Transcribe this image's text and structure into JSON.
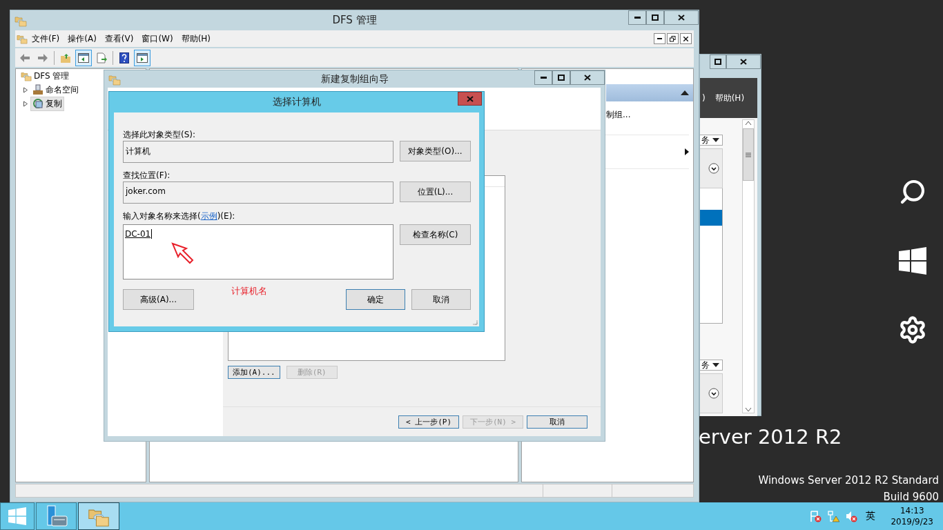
{
  "desktop": {
    "brand_text": "erver 2012 R2",
    "edition": "Windows Server 2012 R2 Standard",
    "build": "Build 9600"
  },
  "charms": [
    {
      "kind": "search"
    },
    {
      "kind": "start"
    },
    {
      "kind": "settings"
    }
  ],
  "back_window": {
    "menu": [
      ")",
      "帮助(H)"
    ],
    "dropdowns": [
      "务",
      "务"
    ]
  },
  "dfs_window": {
    "title": "DFS 管理",
    "menu": [
      "文件(F)",
      "操作(A)",
      "查看(V)",
      "窗口(W)",
      "帮助(H)"
    ],
    "toolbar": [
      {
        "kind": "back",
        "pressed": false
      },
      {
        "kind": "forward",
        "pressed": false
      },
      {
        "kind": "up",
        "pressed": false
      },
      {
        "kind": "tree-pane",
        "pressed": true
      },
      {
        "kind": "export",
        "pressed": false
      },
      {
        "kind": "help",
        "pressed": false
      },
      {
        "kind": "action-pane",
        "pressed": true
      }
    ],
    "tree": [
      {
        "label": "DFS 管理",
        "selected": false,
        "children": [
          {
            "label": "命名空间",
            "selected": false,
            "expanded": false,
            "kind": "namespace"
          },
          {
            "label": "复制",
            "selected": true,
            "expanded": false,
            "kind": "replication"
          }
        ]
      }
    ],
    "actions": {
      "items": [
        {
          "label": "制组...",
          "submenu": false
        },
        {
          "submenu": true
        }
      ]
    }
  },
  "wizard": {
    "title": "新建复制组向导",
    "list_buttons": [
      {
        "label": "添加(A)...",
        "disabled": false
      },
      {
        "label": "删除(R)",
        "disabled": true
      }
    ],
    "nav_buttons": [
      {
        "label": "< 上一步(P)",
        "disabled": false
      },
      {
        "label": "下一步(N) >",
        "disabled": true
      },
      {
        "label": "取消",
        "disabled": false
      }
    ]
  },
  "dialog": {
    "title": "选择计算机",
    "fields": [
      {
        "label": "选择此对象类型(S):",
        "value": "计算机",
        "button": "对象类型(O)..."
      },
      {
        "label": "查找位置(F):",
        "value": "joker.com",
        "button": "位置(L)..."
      }
    ],
    "name_entry": {
      "label_before": "输入对象名称来选择(",
      "link": "示例",
      "label_after": ")(E):",
      "value": "DC-01",
      "button": "检查名称(C)"
    },
    "buttons": [
      {
        "label": "高级(A)...",
        "default": false
      },
      {
        "label": "确定",
        "default": true
      },
      {
        "label": "取消",
        "default": false
      }
    ],
    "annotation": "计算机名"
  },
  "taskbar": {
    "items": [
      {
        "kind": "start",
        "active": false
      },
      {
        "kind": "server-manager",
        "active": false
      },
      {
        "kind": "dfs",
        "active": true
      }
    ],
    "tray": [
      {
        "kind": "flag"
      },
      {
        "kind": "network"
      },
      {
        "kind": "volume"
      }
    ],
    "ime": "英",
    "time": "14:13",
    "date": "2019/9/23"
  }
}
